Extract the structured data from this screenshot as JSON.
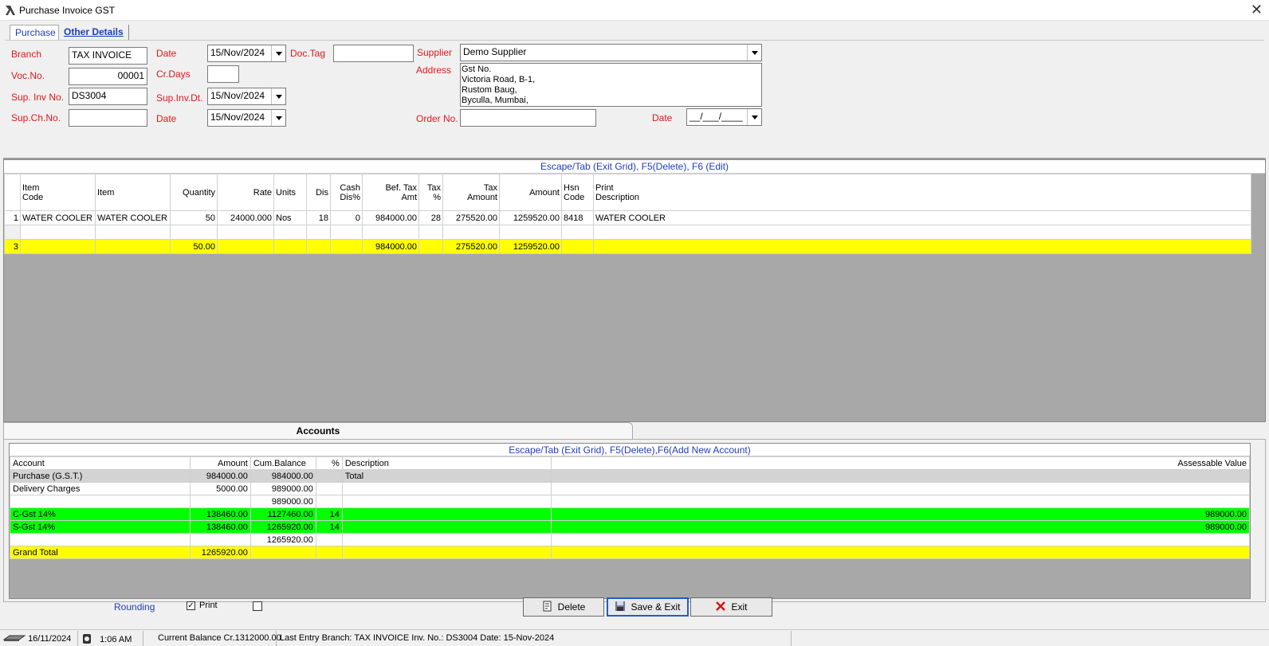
{
  "window": {
    "title": "Purchase Invoice GST"
  },
  "tabs": [
    {
      "label": "Purchase"
    },
    {
      "label": "Other Details"
    }
  ],
  "form": {
    "branch_label": "Branch",
    "branch_value": "TAX INVOICE",
    "date_label": "Date",
    "date_value": "15/Nov/2024",
    "doctag_label": "Doc.Tag",
    "doctag_value": "",
    "supplier_label": "Supplier",
    "supplier_value": "Demo Supplier",
    "vocno_label": "Voc.No.",
    "vocno_value": "00001",
    "crdays_label": "Cr.Days",
    "crdays_value": "",
    "address_label": "Address",
    "address_lines": [
      "Gst No.",
      "Victoria Road, B-1,",
      "Rustom Baug,",
      "Byculla, Mumbai,"
    ],
    "supinv_label": "Sup. Inv No.",
    "supinv_value": "DS3004",
    "supinvdt_label": "Sup.Inv.Dt.",
    "supinvdt_value": "15/Nov/2024",
    "supch_label": "Sup.Ch.No.",
    "supch_value": "",
    "date2_label": "Date",
    "date2_value": "15/Nov/2024",
    "order_label": "Order No.",
    "order_value": "",
    "date3_label": "Date",
    "date3_value": "__/___/____"
  },
  "items_grid": {
    "hint": "Escape/Tab (Exit Grid), F5(Delete), F6 (Edit)",
    "headers": [
      [
        "Item",
        "Code"
      ],
      [
        "Item"
      ],
      [
        "Quantity"
      ],
      [
        "Rate"
      ],
      [
        "Units"
      ],
      [
        "Dis"
      ],
      [
        "Cash",
        "Dis%"
      ],
      [
        "Bef. Tax",
        "Amt"
      ],
      [
        "Tax",
        "%"
      ],
      [
        "Tax",
        "Amount"
      ],
      [
        "Amount"
      ],
      [
        "Hsn",
        "Code"
      ],
      [
        "Print",
        "Description"
      ]
    ],
    "rows": [
      {
        "no": "1",
        "code": "WATER COOLER",
        "item": "WATER COOLER",
        "qty": "50",
        "rate": "24000.000",
        "units": "Nos",
        "dis": "18",
        "cash": "0",
        "bef": "984000.00",
        "taxp": "28",
        "taxamt": "275520.00",
        "amount": "1259520.00",
        "hsn": "8418",
        "desc": "WATER COOLER"
      }
    ],
    "total": {
      "no": "3",
      "qty": "50.00",
      "bef": "984000.00",
      "taxamt": "275520.00",
      "amount": "1259520.00"
    }
  },
  "accounts": {
    "tab_label": "Accounts",
    "hint": "Escape/Tab (Exit Grid), F5(Delete),F6(Add New Account)",
    "headers": {
      "account": "Account",
      "amount": "Amount",
      "cum": "Cum.Balance",
      "pct": "%",
      "desc": "Description",
      "assess": "Assessable Value"
    },
    "rows": [
      {
        "style": "gray",
        "account": "Purchase (G.S.T.)",
        "amount": "984000.00",
        "cum": "984000.00",
        "pct": "",
        "desc": "Total",
        "assess": ""
      },
      {
        "style": "white",
        "account": "Delivery Charges",
        "amount": "5000.00",
        "cum": "989000.00",
        "pct": "",
        "desc": "",
        "assess": ""
      },
      {
        "style": "white",
        "account": "",
        "amount": "",
        "cum": "989000.00",
        "pct": "",
        "desc": "",
        "assess": ""
      },
      {
        "style": "green",
        "account": "C-Gst 14%",
        "amount": "138460.00",
        "cum": "1127460.00",
        "pct": "14",
        "desc": "",
        "assess": "989000.00"
      },
      {
        "style": "green",
        "account": "S-Gst 14%",
        "amount": "138460.00",
        "cum": "1265920.00",
        "pct": "14",
        "desc": "",
        "assess": "989000.00"
      },
      {
        "style": "white",
        "account": "",
        "amount": "",
        "cum": "1265920.00",
        "pct": "",
        "desc": "",
        "assess": ""
      },
      {
        "style": "yellow",
        "account": "Grand Total",
        "amount": "1265920.00",
        "cum": "",
        "pct": "",
        "desc": "",
        "assess": ""
      }
    ]
  },
  "bottom": {
    "rounding_label": "Rounding",
    "print_label": "Print",
    "delete_label": "Delete",
    "save_label": "Save & Exit",
    "exit_label": "Exit"
  },
  "status": {
    "date": "16/11/2024",
    "time": "1:06 AM",
    "balance": "Current Balance Cr.1312000.00",
    "last_entry": "Last Entry  Branch: TAX INVOICE Inv. No.: DS3004 Date: 15-Nov-2024"
  },
  "colors": {
    "label_red": "#e0181c",
    "link_blue": "#1f3dbf",
    "total_yellow": "#ffff00",
    "tax_green": "#00ff00"
  }
}
